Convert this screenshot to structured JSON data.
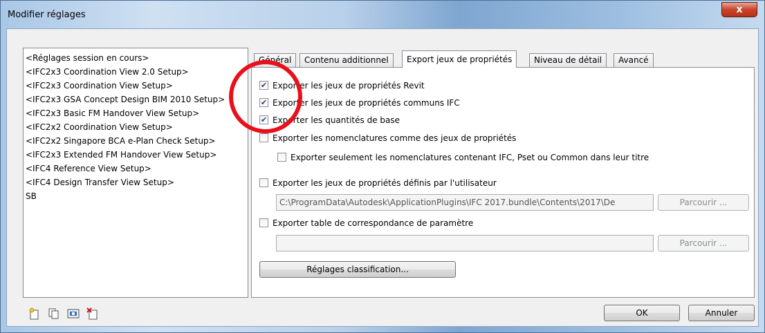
{
  "window": {
    "title": "Modifier réglages",
    "close_label": "x"
  },
  "setups": [
    "<Réglages session en cours>",
    "<IFC2x3 Coordination View 2.0 Setup>",
    "<IFC2x3 Coordination View Setup>",
    "<IFC2x3 GSA Concept Design BIM 2010 Setup>",
    "<IFC2x3 Basic FM Handover View Setup>",
    "<IFC2x2 Coordination View Setup>",
    "<IFC2x2 Singapore BCA e-Plan Check Setup>",
    "<IFC2x3 Extended FM Handover View Setup>",
    "<IFC4 Reference View Setup>",
    "<IFC4 Design Transfer View Setup>",
    "SB"
  ],
  "tabs": [
    "Général",
    "Contenu additionnel",
    "Export jeux de propriétés",
    "Niveau de détail",
    "Avancé"
  ],
  "options": {
    "revit_psets": {
      "label": "Exporter les jeux de propriétés Revit",
      "checked": true
    },
    "ifc_common": {
      "label": "Exporter les jeux de propriétés communs  IFC",
      "checked": true
    },
    "base_quantities": {
      "label": "Exporter les quantités de base",
      "checked": true
    },
    "schedules": {
      "label": "Exporter les nomenclatures comme des jeux de propriétés",
      "checked": false
    },
    "schedules_only": {
      "label": "Exporter seulement les nomenclatures contenant IFC, Pset ou Common dans leur titre",
      "checked": false
    },
    "user_psets": {
      "label": "Exporter les jeux de propriétés définis par l'utilisateur",
      "checked": false
    },
    "user_psets_path": "C:\\ProgramData\\Autodesk\\ApplicationPlugins\\IFC 2017.bundle\\Contents\\2017\\De",
    "param_mapping": {
      "label": "Exporter table de correspondance de paramètre",
      "checked": false
    },
    "param_mapping_path": ""
  },
  "buttons": {
    "browse": "Parcourir ...",
    "classification": "Réglages classification...",
    "ok": "OK",
    "cancel": "Annuler"
  },
  "check_glyph": "✔",
  "colors": {
    "highlight_circle": "#e8101a"
  }
}
